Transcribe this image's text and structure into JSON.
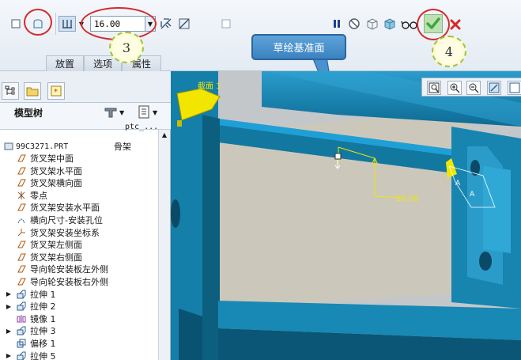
{
  "dashboard": {
    "depth_value": "16.00",
    "tabs": [
      "放置",
      "选项",
      "属性"
    ],
    "tooltip": "草绘基准面",
    "callouts": [
      "3",
      "4"
    ]
  },
  "tree": {
    "title": "模型树",
    "column_header": "ptc_...",
    "root": {
      "name": "99C3271.PRT",
      "extra": "骨架"
    },
    "items": [
      "货叉架中面",
      "货叉架水平面",
      "货叉架横向面",
      "零点",
      "货叉架安装水平面",
      "横向尺寸-安装孔位",
      "货叉架安装坐标系",
      "货叉架左侧面",
      "货叉架右侧面",
      "导向轮安装板左外侧",
      "导向轮安装板右外侧",
      "拉伸 1",
      "拉伸 2",
      "镜像 1",
      "拉伸 3",
      "偏移 1",
      "拉伸 5"
    ]
  },
  "graphics": {
    "plane_label": "截面 1",
    "dimension": "16.00"
  },
  "colors": {
    "model_blue": "#1a7ea8",
    "model_dark": "#0d5c7d",
    "sketch_yellow": "#f2e600",
    "accept_green": "#3aa838",
    "cancel_red": "#d42a2a",
    "callout_ring": "#d42a2a",
    "tooltip_blue": "#4a92cf"
  },
  "icons": [
    "solid-icon",
    "surface-icon",
    "depth-option-icon",
    "flip-direction-icon",
    "remove-material-icon",
    "thicken-icon",
    "pause-icon",
    "no-preview-icon",
    "verify-icon",
    "preview-icon",
    "glasses-icon",
    "accept-icon",
    "cancel-icon",
    "refit-icon",
    "zoom-in-icon",
    "zoom-out-icon",
    "repaint-icon"
  ]
}
